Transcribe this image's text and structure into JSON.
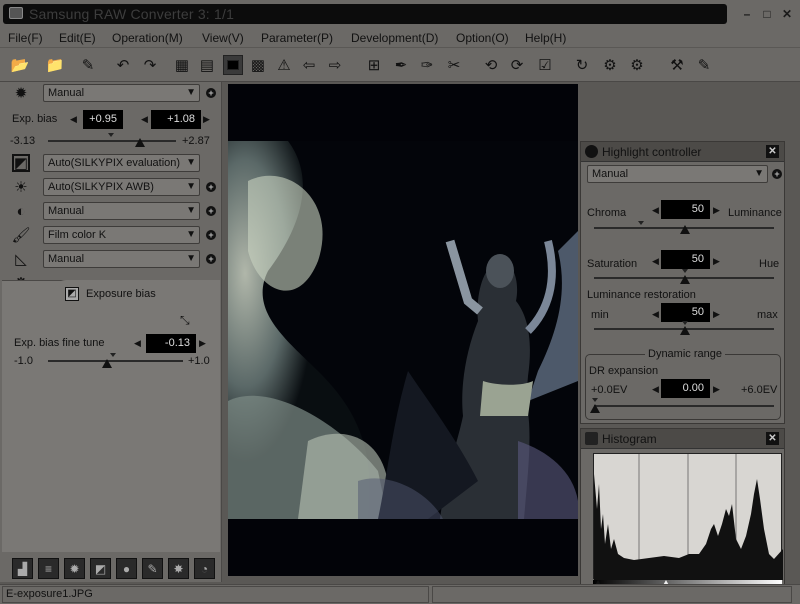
{
  "window": {
    "title": "Samsung RAW Converter 3:  1/1",
    "minimize": "–",
    "maximize": "□",
    "close": "✕"
  },
  "menu": [
    {
      "label": "File(F)"
    },
    {
      "label": "Edit(E)"
    },
    {
      "label": "Operation(M)"
    },
    {
      "label": "View(V)"
    },
    {
      "label": "Parameter(P)"
    },
    {
      "label": "Development(D)"
    },
    {
      "label": "Option(O)"
    },
    {
      "label": "Help(H)"
    }
  ],
  "left_panel": {
    "exposure_preset": "Manual",
    "exp_bias_label": "Exp. bias",
    "exp_bias_value": "+0.95",
    "exp_bias_value2": "+1.08",
    "exp_bias_min": "-3.13",
    "exp_bias_max": "+2.87",
    "white_balance_mode": "Auto(SILKYPIX evaluation)",
    "white_balance_awb": "Auto(SILKYPIX AWB)",
    "contrast_preset": "Manual",
    "color_preset": "Film color K",
    "sharpness_preset": "Manual",
    "sub_tab_title": "Exposure bias",
    "fine_tune_label": "Exp. bias fine tune",
    "fine_tune_value": "-0.13",
    "fine_tune_min": "-1.0",
    "fine_tune_max": "+1.0",
    "fine_tune_level": 0.44,
    "exp_bias_level": 0.72
  },
  "highlight_controller": {
    "title": "Highlight controller",
    "preset": "Manual",
    "chroma_label": "Chroma",
    "luminance_label": "Luminance",
    "chroma_luminance_value": "50",
    "saturation_label": "Saturation",
    "hue_label": "Hue",
    "saturation_hue_value": "50",
    "luminance_restoration_label": "Luminance restoration",
    "min_label": "min",
    "max_label": "max",
    "luminance_restoration_value": "50",
    "dynamic_range_label": "Dynamic range",
    "dr_expansion_label": "DR expansion",
    "dr_min": "+0.0EV",
    "dr_max": "+6.0EV",
    "dr_value": "0.00"
  },
  "histogram": {
    "title": "Histogram"
  },
  "status": {
    "filename": "E-exposure1.JPG"
  },
  "colors": {
    "panel_bg": "#6b6966",
    "viewer_bg": "#020308",
    "value_box": "#000000"
  }
}
